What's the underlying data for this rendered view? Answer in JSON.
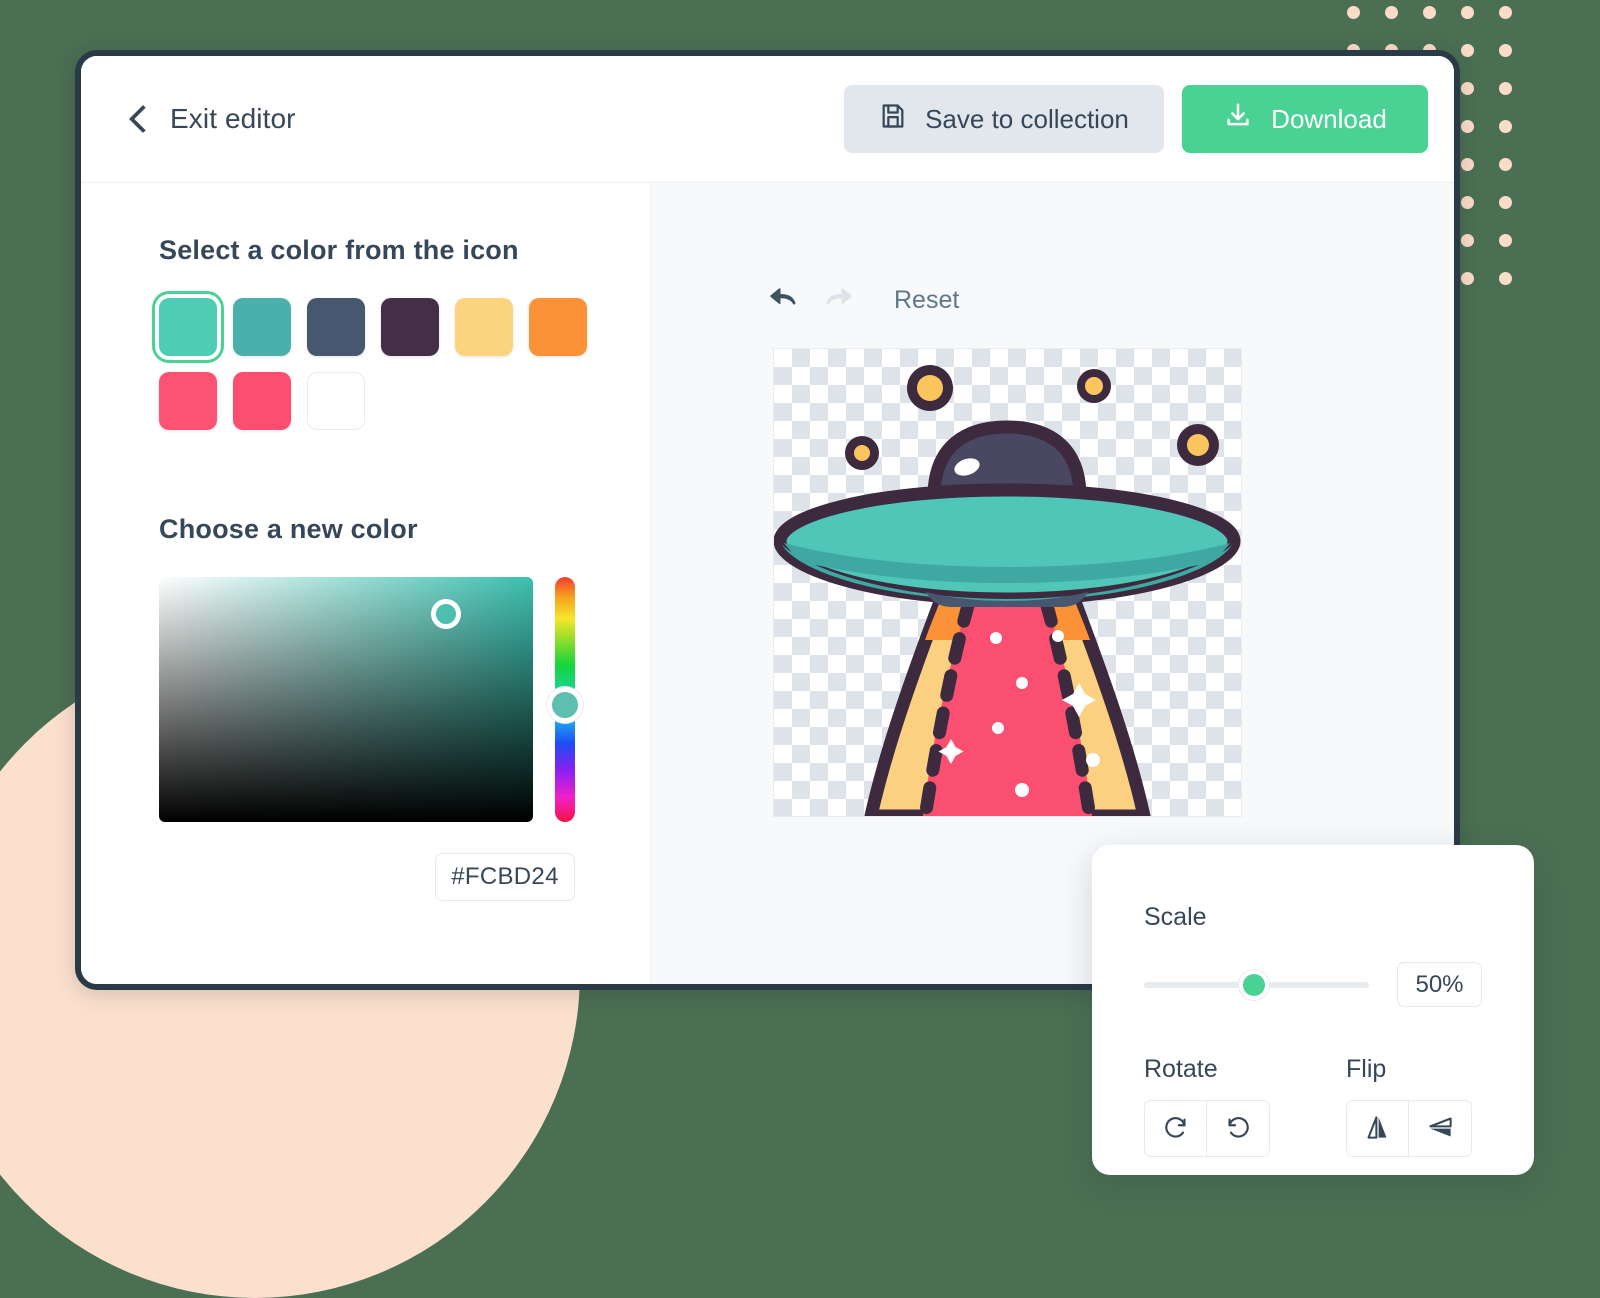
{
  "theme": {
    "page_background": "#4b6f53",
    "accent_green": "#4AD194",
    "text_dark": "#37475A",
    "panel_gray": "#E1E7EC",
    "deco_dot_color": "#FBDCC8",
    "deco_circle_color": "#FCE0CE"
  },
  "header": {
    "exit_label": "Exit editor",
    "back_icon": "chevron-left-icon",
    "save_label": "Save to collection",
    "save_icon": "floppy-disk-icon",
    "download_label": "Download",
    "download_icon": "download-icon"
  },
  "left_panel": {
    "select_color_heading": "Select a color from the icon",
    "choose_color_heading": "Choose a new color",
    "swatches": [
      {
        "name": "swatch-mint",
        "hex": "#4FCDB4",
        "selected": true,
        "white": false
      },
      {
        "name": "swatch-teal",
        "hex": "#4BB0AB",
        "selected": false,
        "white": false
      },
      {
        "name": "swatch-slate",
        "hex": "#47576F",
        "selected": false,
        "white": false
      },
      {
        "name": "swatch-plum",
        "hex": "#452F48",
        "selected": false,
        "white": false
      },
      {
        "name": "swatch-light-yellow",
        "hex": "#FCD480",
        "selected": false,
        "white": false
      },
      {
        "name": "swatch-orange",
        "hex": "#FB9238",
        "selected": false,
        "white": false
      },
      {
        "name": "swatch-pink-1",
        "hex": "#FC5372",
        "selected": false,
        "white": false
      },
      {
        "name": "swatch-pink-2",
        "hex": "#FC4F6F",
        "selected": false,
        "white": false
      },
      {
        "name": "swatch-white",
        "hex": "#FFFFFF",
        "selected": false,
        "white": true
      }
    ],
    "picker": {
      "hex_value": "#FCBD24",
      "hex_placeholder": "#000000",
      "handle_color": "#4CC0AE",
      "hue_handle_color": "#5EBEB0"
    }
  },
  "right_panel": {
    "undo_icon": "undo-arrow-icon",
    "redo_icon": "redo-arrow-icon",
    "reset_label": "Reset",
    "artwork": {
      "name": "ufo-illustration",
      "outline": "#3E2A3E",
      "dome": "#4A4763",
      "dome_highlight": "#FFFFFF",
      "saucer_top": "#4FC6B8",
      "saucer_bottom": "#3FA8A3",
      "beam_outer": "#FBD181",
      "beam_outer_top": "#FB9238",
      "beam_inner": "#FB4F72",
      "star_dot_fill": "#FBC55E",
      "sparkle": "#FFFFFF"
    }
  },
  "transform_panel": {
    "scale_label": "Scale",
    "scale_value": "50%",
    "rotate_label": "Rotate",
    "rotate_cw_icon": "rotate-clockwise-icon",
    "rotate_ccw_icon": "rotate-counterclockwise-icon",
    "flip_label": "Flip",
    "flip_horizontal_icon": "flip-horizontal-icon",
    "flip_vertical_icon": "flip-vertical-icon"
  }
}
